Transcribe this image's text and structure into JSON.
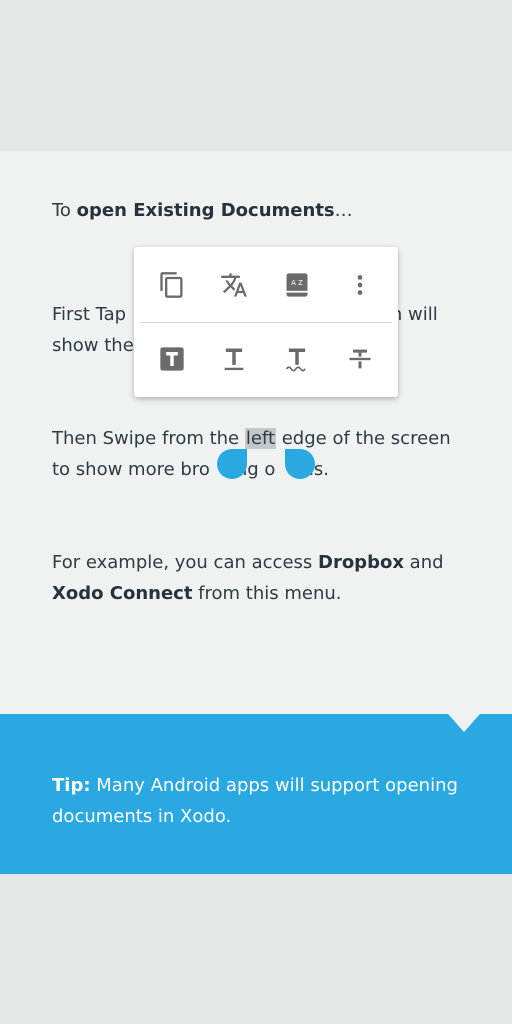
{
  "doc": {
    "p1": {
      "a": "To ",
      "b": "open Existing Documents",
      "c": "…"
    },
    "p2": {
      "line1_left": "First Tap",
      "line1_right": "ch will",
      "line2_left": "show the"
    },
    "p3": {
      "a": "Then Swipe from the ",
      "selected": "left",
      "b": " edge of the screen",
      "line2a": "to show more bro",
      "line2b": "ng o",
      "line2c": "ons."
    },
    "p4": {
      "a": "For example, you can access ",
      "b": "Dropbox",
      "c": " and",
      "d": "Xodo Connect",
      "e": " from this menu."
    }
  },
  "tip": {
    "label": "Tip:",
    "text": " Many Android apps will support opening documents in Xodo."
  },
  "popup": {
    "row1": [
      "copy-icon",
      "translate-icon",
      "dictionary-icon",
      "more-vert-icon"
    ],
    "row2": [
      "highlight-icon",
      "underline-icon",
      "squiggly-icon",
      "strikeout-icon"
    ],
    "dictionary_glyph": "A Z"
  },
  "colors": {
    "accent": "#29a8e1",
    "page": "#f0f2f1",
    "background": "#e4e7e6",
    "text": "#2f3a45",
    "icon": "#6b6b6b"
  }
}
